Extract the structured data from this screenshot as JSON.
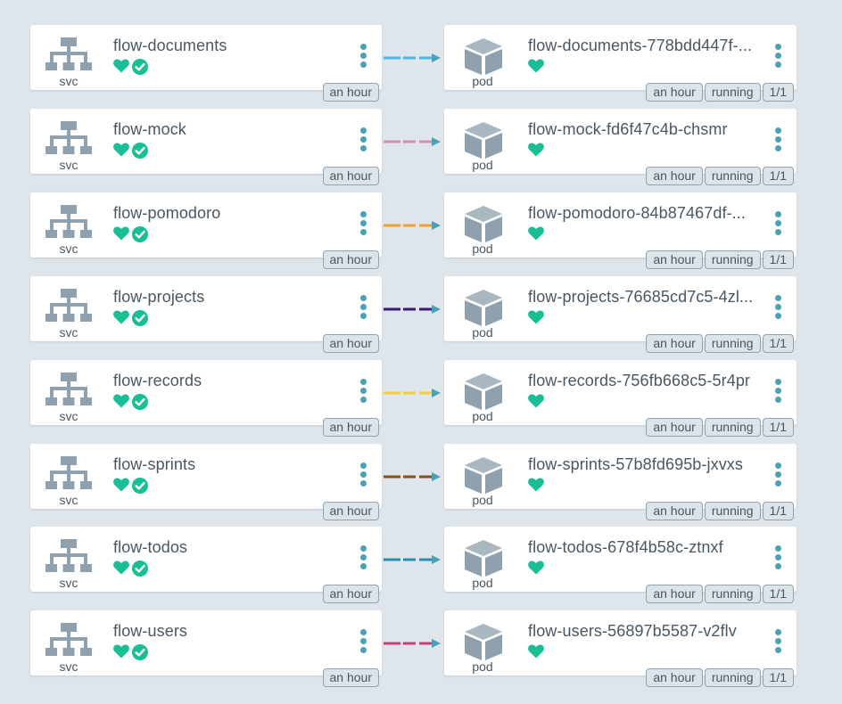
{
  "colors": {
    "background": "#dee6eb",
    "card": "#ffffff",
    "text": "#495763",
    "icon": "#8fa1ae",
    "health": "#18be94",
    "menu": "#4d9fb3",
    "arrow": "#4d9fb3"
  },
  "rows": [
    {
      "svc": {
        "name": "flow-documents",
        "kind": "svc",
        "age": "an hour",
        "icons": [
          "heart-icon",
          "check-circle-icon"
        ]
      },
      "edge_color": "#4db6e6",
      "pod": {
        "name": "flow-documents-778bdd447f-...",
        "kind": "pod",
        "age": "an hour",
        "status": "running",
        "ready": "1/1",
        "icons": [
          "heart-icon"
        ]
      }
    },
    {
      "svc": {
        "name": "flow-mock",
        "kind": "svc",
        "age": "an hour",
        "icons": [
          "heart-icon",
          "check-circle-icon"
        ]
      },
      "edge_color": "#d98db0",
      "pod": {
        "name": "flow-mock-fd6f47c4b-chsmr",
        "kind": "pod",
        "age": "an hour",
        "status": "running",
        "ready": "1/1",
        "icons": [
          "heart-icon"
        ]
      }
    },
    {
      "svc": {
        "name": "flow-pomodoro",
        "kind": "svc",
        "age": "an hour",
        "icons": [
          "heart-icon",
          "check-circle-icon"
        ]
      },
      "edge_color": "#f0a030",
      "pod": {
        "name": "flow-pomodoro-84b87467df-...",
        "kind": "pod",
        "age": "an hour",
        "status": "running",
        "ready": "1/1",
        "icons": [
          "heart-icon"
        ]
      }
    },
    {
      "svc": {
        "name": "flow-projects",
        "kind": "svc",
        "age": "an hour",
        "icons": [
          "heart-icon",
          "check-circle-icon"
        ]
      },
      "edge_color": "#3a1a7a",
      "pod": {
        "name": "flow-projects-76685cd7c5-4zl...",
        "kind": "pod",
        "age": "an hour",
        "status": "running",
        "ready": "1/1",
        "icons": [
          "heart-icon"
        ]
      }
    },
    {
      "svc": {
        "name": "flow-records",
        "kind": "svc",
        "age": "an hour",
        "icons": [
          "heart-icon",
          "check-circle-icon"
        ]
      },
      "edge_color": "#f0d040",
      "pod": {
        "name": "flow-records-756fb668c5-5r4pr",
        "kind": "pod",
        "age": "an hour",
        "status": "running",
        "ready": "1/1",
        "icons": [
          "heart-icon"
        ]
      }
    },
    {
      "svc": {
        "name": "flow-sprints",
        "kind": "svc",
        "age": "an hour",
        "icons": [
          "heart-icon",
          "check-circle-icon"
        ]
      },
      "edge_color": "#8a4f18",
      "pod": {
        "name": "flow-sprints-57b8fd695b-jxvxs",
        "kind": "pod",
        "age": "an hour",
        "status": "running",
        "ready": "1/1",
        "icons": [
          "heart-icon"
        ]
      }
    },
    {
      "svc": {
        "name": "flow-todos",
        "kind": "svc",
        "age": "an hour",
        "icons": [
          "heart-icon",
          "check-circle-icon"
        ]
      },
      "edge_color": "#2f8ab0",
      "pod": {
        "name": "flow-todos-678f4b58c-ztnxf",
        "kind": "pod",
        "age": "an hour",
        "status": "running",
        "ready": "1/1",
        "icons": [
          "heart-icon"
        ]
      }
    },
    {
      "svc": {
        "name": "flow-users",
        "kind": "svc",
        "age": "an hour",
        "icons": [
          "heart-icon",
          "check-circle-icon"
        ]
      },
      "edge_color": "#c8407a",
      "pod": {
        "name": "flow-users-56897b5587-v2flv",
        "kind": "pod",
        "age": "an hour",
        "status": "running",
        "ready": "1/1",
        "icons": [
          "heart-icon"
        ]
      }
    }
  ]
}
